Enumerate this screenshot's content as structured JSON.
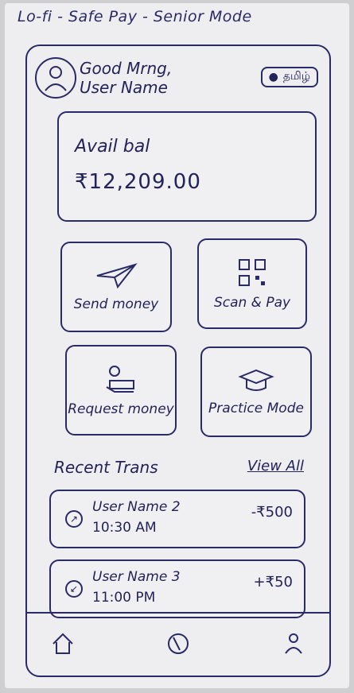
{
  "app": {
    "title": "Lo-fi - Safe Pay - Senior Mode"
  },
  "header": {
    "greeting_line1": "Good Mrng,",
    "greeting_line2": "User Name",
    "language_button": "தமிழ்"
  },
  "balance": {
    "label": "Avail bal",
    "value": "₹12,209.00"
  },
  "actions": [
    {
      "label": "Send money",
      "icon": "paper-plane-icon"
    },
    {
      "label": "Scan & Pay",
      "icon": "qr-code-icon"
    },
    {
      "label": "Request money",
      "icon": "request-money-icon"
    },
    {
      "label": "Practice Mode",
      "icon": "graduation-cap-icon"
    }
  ],
  "recent": {
    "title": "Recent Trans",
    "view_all": "View All",
    "items": [
      {
        "name": "User Name 2",
        "time": "10:30 AM",
        "amount": "-₹500",
        "icon": "outgoing-arrow-icon"
      },
      {
        "name": "User Name 3",
        "time": "11:00 PM",
        "amount": "+₹50",
        "icon": "incoming-arrow-icon"
      }
    ]
  },
  "nav": {
    "items": [
      "home-icon",
      "history-icon",
      "profile-icon"
    ]
  },
  "colors": {
    "ink": "#2a2a66",
    "paper": "#eeedf0"
  }
}
